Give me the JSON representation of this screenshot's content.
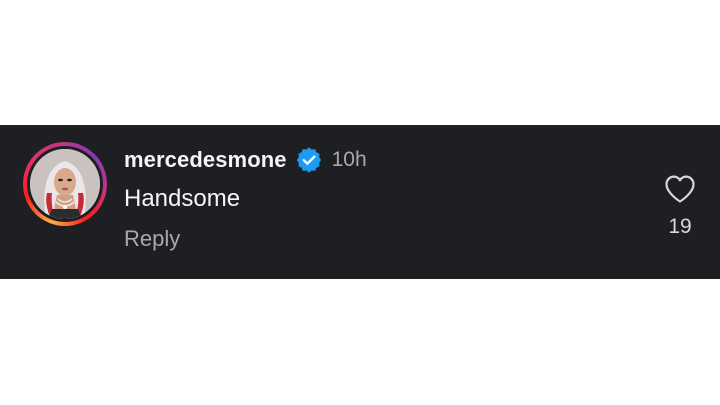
{
  "comment": {
    "username": "mercedesmone",
    "verified_icon": "verified-badge-icon",
    "timestamp": "10h",
    "text": "Handsome",
    "reply_label": "Reply",
    "like_icon": "heart-icon",
    "like_count": "19"
  },
  "colors": {
    "background": "#1e1f23",
    "verified_blue": "#1d9bf0",
    "text_primary": "#f5f5f5",
    "text_secondary": "#a8a8ad"
  }
}
